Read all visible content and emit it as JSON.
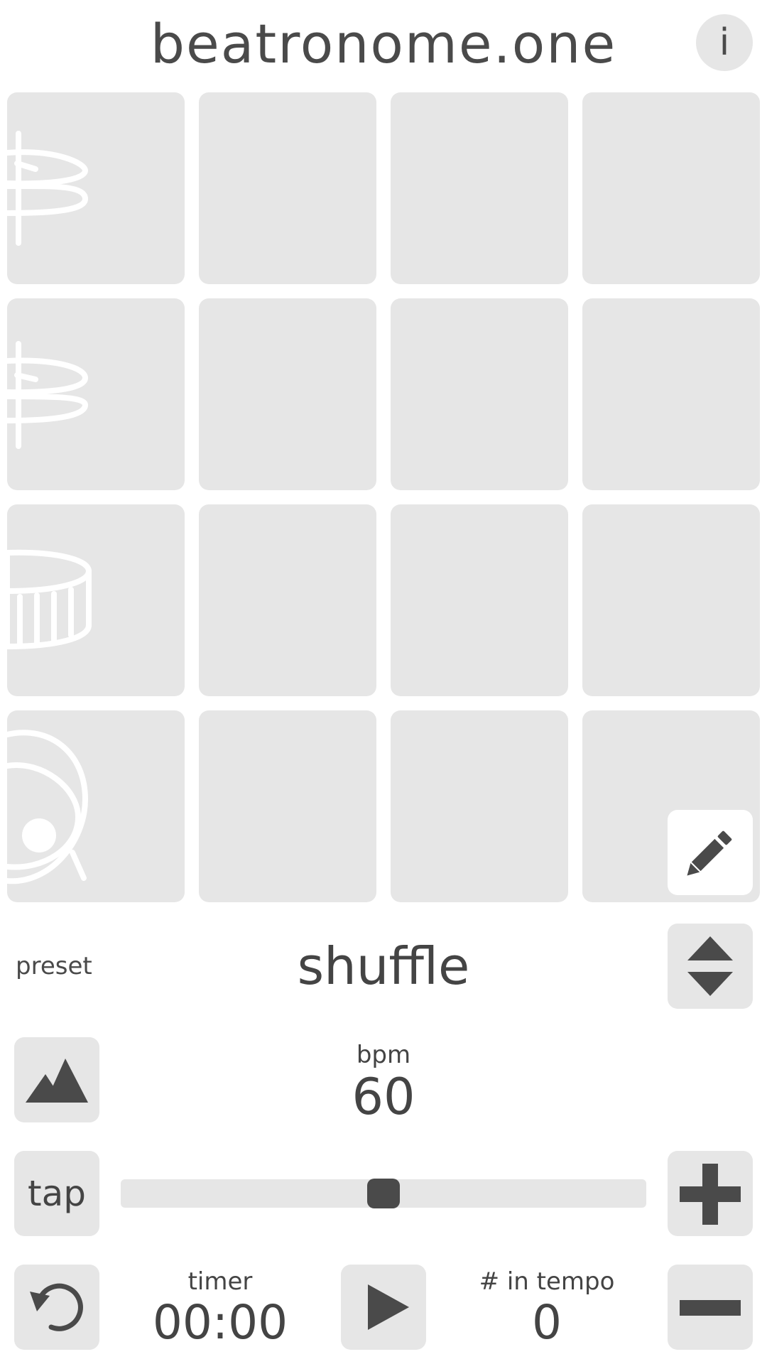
{
  "app": {
    "title": "beatronome.one",
    "info_label": "i"
  },
  "grid": {
    "rows": [
      {
        "instrument_icon": "cymbal-icon"
      },
      {
        "instrument_icon": "hihat-icon"
      },
      {
        "instrument_icon": "snare-drum-icon"
      },
      {
        "instrument_icon": "bass-drum-icon"
      }
    ],
    "columns": 4
  },
  "preset": {
    "label": "preset",
    "name": "shuffle"
  },
  "bpm": {
    "label": "bpm",
    "value": "60",
    "slider_fraction": 0.5
  },
  "controls": {
    "tap_label": "tap"
  },
  "timer": {
    "label": "timer",
    "value": "00:00"
  },
  "tempo_count": {
    "label": "# in tempo",
    "value": "0"
  },
  "colors": {
    "background": "#ffffff",
    "cell": "#e6e6e6",
    "icon_dark": "#4a4a4a",
    "icon_light": "#ffffff"
  }
}
